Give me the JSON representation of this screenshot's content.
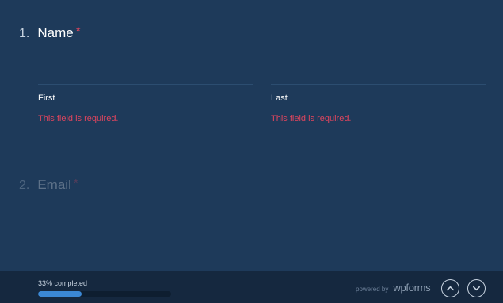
{
  "questions": [
    {
      "number": "1.",
      "title": "Name",
      "required_mark": "*"
    },
    {
      "number": "2.",
      "title": "Email",
      "required_mark": "*"
    }
  ],
  "name_fields": {
    "first": {
      "label": "First",
      "error": "This field is required."
    },
    "last": {
      "label": "Last",
      "error": "This field is required."
    }
  },
  "footer": {
    "progress_text": "33% completed",
    "progress_fraction": 0.33,
    "powered_by": "powered by",
    "brand": "wpforms",
    "up_icon": "chevron-up-icon",
    "down_icon": "chevron-down-icon"
  },
  "colors": {
    "background": "#1e3a5a",
    "footer": "#15283f",
    "error": "#e0455e",
    "progress": "#3b88d5"
  }
}
